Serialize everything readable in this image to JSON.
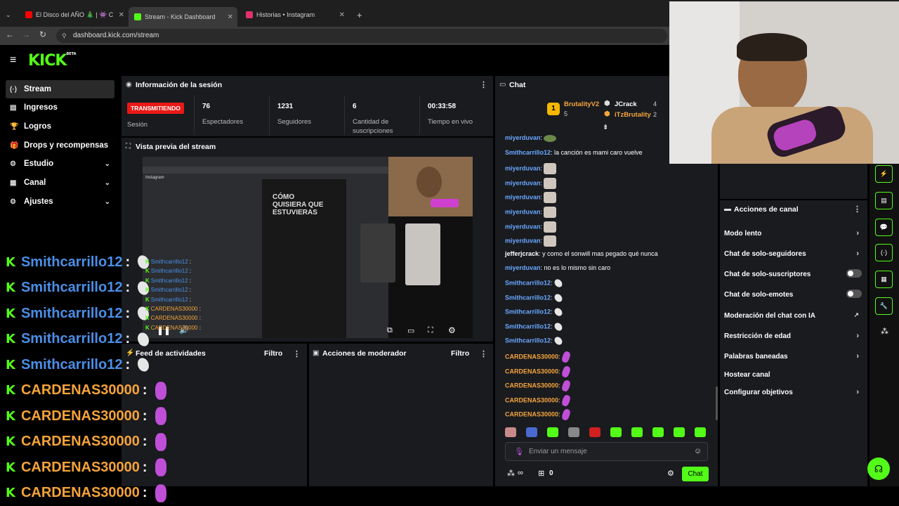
{
  "browser": {
    "tabs": [
      {
        "title": "El Disco del AÑO 🎄 | 👾 C",
        "favicon_color": "#ff0000"
      },
      {
        "title": "Stream - Kick Dashboard",
        "favicon_color": "#53fc18"
      },
      {
        "title": "Historias • Instagram",
        "favicon_color": "#e1306c"
      }
    ],
    "new_tab": "+",
    "url": "dashboard.kick.com/stream"
  },
  "kick": {
    "logo": "KICK",
    "logo_badge": "BETA"
  },
  "sidebar": {
    "items": [
      {
        "label": "Stream",
        "icon": "stream-icon",
        "glyph": "(·)"
      },
      {
        "label": "Ingresos",
        "icon": "income-icon",
        "glyph": "▤"
      },
      {
        "label": "Logros",
        "icon": "trophy-icon",
        "glyph": "🏆"
      },
      {
        "label": "Drops y recompensas",
        "icon": "gift-icon",
        "glyph": "🎁"
      },
      {
        "label": "Estudio",
        "icon": "studio-icon",
        "glyph": "⚙"
      },
      {
        "label": "Canal",
        "icon": "channel-icon",
        "glyph": "▦"
      },
      {
        "label": "Ajustes",
        "icon": "settings-icon",
        "glyph": "⚙"
      }
    ]
  },
  "session": {
    "title": "Información de la sesión",
    "status_badge": "TRANSMITIENDO",
    "status_label": "Sesión",
    "stats": [
      {
        "value": "76",
        "label": "Espectadores"
      },
      {
        "value": "1231",
        "label": "Seguidores"
      },
      {
        "value": "6",
        "label": "Cantidad de suscripciones"
      },
      {
        "value": "00:33:58",
        "label": "Tiempo en vivo"
      }
    ]
  },
  "preview": {
    "title": "Vista previa del stream",
    "video_text_line1": "CÓMO",
    "video_text_line2": "QUISIERA QUE",
    "video_text_line3": "ESTUVIERAS",
    "video_brand": "Instagram"
  },
  "activity": {
    "title": "Feed de actividades",
    "filter": "Filtro"
  },
  "mod": {
    "title": "Acciones de moderador",
    "filter": "Filtro"
  },
  "chat": {
    "title": "Chat",
    "leaderboard": [
      {
        "rank": "1",
        "name": "BrutalityV2",
        "count": "5"
      },
      {
        "name": "JCrack",
        "count": "4"
      },
      {
        "name": "iTzBrutality",
        "count": "2"
      }
    ],
    "messages": [
      {
        "user": "miyerduvan",
        "color": "blue",
        "text": "",
        "emote": "fr"
      },
      {
        "user": "Smithcarrillo12",
        "color": "blue",
        "text": "la canción es mami caro vuelve",
        "emote": ""
      },
      {
        "user": "miyerduvan",
        "color": "blue",
        "text": "",
        "emote": "cat"
      },
      {
        "user": "miyerduvan",
        "color": "blue",
        "text": "",
        "emote": "cat"
      },
      {
        "user": "miyerduvan",
        "color": "blue",
        "text": "",
        "emote": "cat"
      },
      {
        "user": "miyerduvan",
        "color": "blue",
        "text": "",
        "emote": "cat"
      },
      {
        "user": "miyerduvan",
        "color": "blue",
        "text": "",
        "emote": "cat"
      },
      {
        "user": "miyerduvan",
        "color": "blue",
        "text": "",
        "emote": "cat"
      },
      {
        "user": "jefferjcrack",
        "color": "white",
        "text": "y como el sonwill mas pegado qué nunca",
        "emote": ""
      },
      {
        "user": "miyerduvan",
        "color": "blue",
        "text": "no es lo mismo sin caro",
        "emote": ""
      },
      {
        "user": "Smithcarrillo12",
        "color": "blue",
        "text": "",
        "emote": "wh"
      },
      {
        "user": "Smithcarrillo12",
        "color": "blue",
        "text": "",
        "emote": "wh"
      },
      {
        "user": "Smithcarrillo12",
        "color": "blue",
        "text": "",
        "emote": "wh"
      },
      {
        "user": "Smithcarrillo12",
        "color": "blue",
        "text": "",
        "emote": "wh"
      },
      {
        "user": "Smithcarrillo12",
        "color": "blue",
        "text": "",
        "emote": "wh"
      },
      {
        "user": "CARDENAS30000",
        "color": "orange",
        "text": "",
        "emote": "pk"
      },
      {
        "user": "CARDENAS30000",
        "color": "orange",
        "text": "",
        "emote": "pk"
      },
      {
        "user": "CARDENAS30000",
        "color": "orange",
        "text": "",
        "emote": "pk"
      },
      {
        "user": "CARDENAS30000",
        "color": "orange",
        "text": "",
        "emote": "pk"
      },
      {
        "user": "CARDENAS30000",
        "color": "orange",
        "text": "",
        "emote": "pk"
      }
    ],
    "input_placeholder": "Enviar un mensaje",
    "points": "∞",
    "gift_count": "0",
    "send_label": "Chat"
  },
  "channel_actions": {
    "title": "Acciones de canal",
    "items": [
      {
        "label": "Modo lento",
        "kind": "chevron"
      },
      {
        "label": "Chat de solo-seguidores",
        "kind": "chevron"
      },
      {
        "label": "Chat de solo-suscriptores",
        "kind": "toggle"
      },
      {
        "label": "Chat de solo-emotes",
        "kind": "toggle"
      },
      {
        "label": "Moderación del chat con IA",
        "kind": "external"
      },
      {
        "label": "Restricción de edad",
        "kind": "chevron"
      },
      {
        "label": "Palabras baneadas",
        "kind": "chevron"
      },
      {
        "label": "Hostear canal",
        "kind": "none"
      },
      {
        "label": "Configurar objetivos",
        "kind": "chevron"
      }
    ]
  },
  "overlay_chat": [
    {
      "user": "Smithcarrillo12",
      "color": "blue",
      "emote": "wh"
    },
    {
      "user": "Smithcarrillo12",
      "color": "blue",
      "emote": "wh"
    },
    {
      "user": "Smithcarrillo12",
      "color": "blue",
      "emote": "wh"
    },
    {
      "user": "Smithcarrillo12",
      "color": "blue",
      "emote": "wh"
    },
    {
      "user": "Smithcarrillo12",
      "color": "blue",
      "emote": "wh"
    },
    {
      "user": "CARDENAS30000",
      "color": "orange",
      "emote": "pk"
    },
    {
      "user": "CARDENAS30000",
      "color": "orange",
      "emote": "pk"
    },
    {
      "user": "CARDENAS30000",
      "color": "orange",
      "emote": "pk"
    },
    {
      "user": "CARDENAS30000",
      "color": "orange",
      "emote": "pk"
    },
    {
      "user": "CARDENAS30000",
      "color": "orange",
      "emote": "pk"
    }
  ],
  "mini_chat": [
    {
      "user": "Smithcarrillo12",
      "color": "blue"
    },
    {
      "user": "Smithcarrillo12",
      "color": "blue"
    },
    {
      "user": "Smithcarrillo12",
      "color": "blue"
    },
    {
      "user": "Smithcarrillo12",
      "color": "blue"
    },
    {
      "user": "Smithcarrillo12",
      "color": "blue"
    },
    {
      "user": "CARDENAS30000",
      "color": "orange"
    },
    {
      "user": "CARDENAS30000",
      "color": "orange"
    },
    {
      "user": "CARDENAS30000",
      "color": "orange"
    }
  ],
  "colors": {
    "brand": "#53fc18",
    "panel": "#191b1f",
    "live_badge": "#e91916",
    "user_blue": "#6aa8ff",
    "user_orange": "#f6a43c"
  }
}
